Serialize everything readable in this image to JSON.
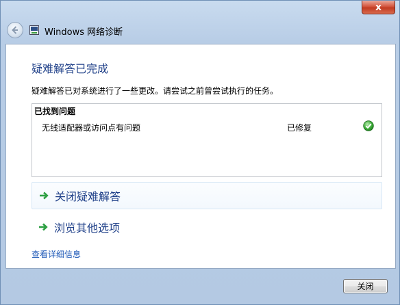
{
  "window": {
    "title": "Windows 网络诊断",
    "close_glyph": "x"
  },
  "main": {
    "heading": "疑难解答已完成",
    "description": "疑难解答已对系统进行了一些更改。请尝试之前曾尝试执行的任务。",
    "found_section": {
      "title": "已找到问题",
      "problems": [
        {
          "name": "无线适配器或访问点有问题",
          "status": "已修复",
          "status_icon": "green-check-icon"
        }
      ]
    },
    "options": [
      {
        "label": "关闭疑难解答",
        "icon": "green-arrow-icon"
      },
      {
        "label": "浏览其他选项",
        "icon": "green-arrow-icon"
      }
    ],
    "details_link": "查看详细信息"
  },
  "footer": {
    "close_label": "关闭"
  },
  "colors": {
    "heading": "#1e3f88",
    "link": "#1a56b6",
    "accent_green": "#2ea043"
  }
}
